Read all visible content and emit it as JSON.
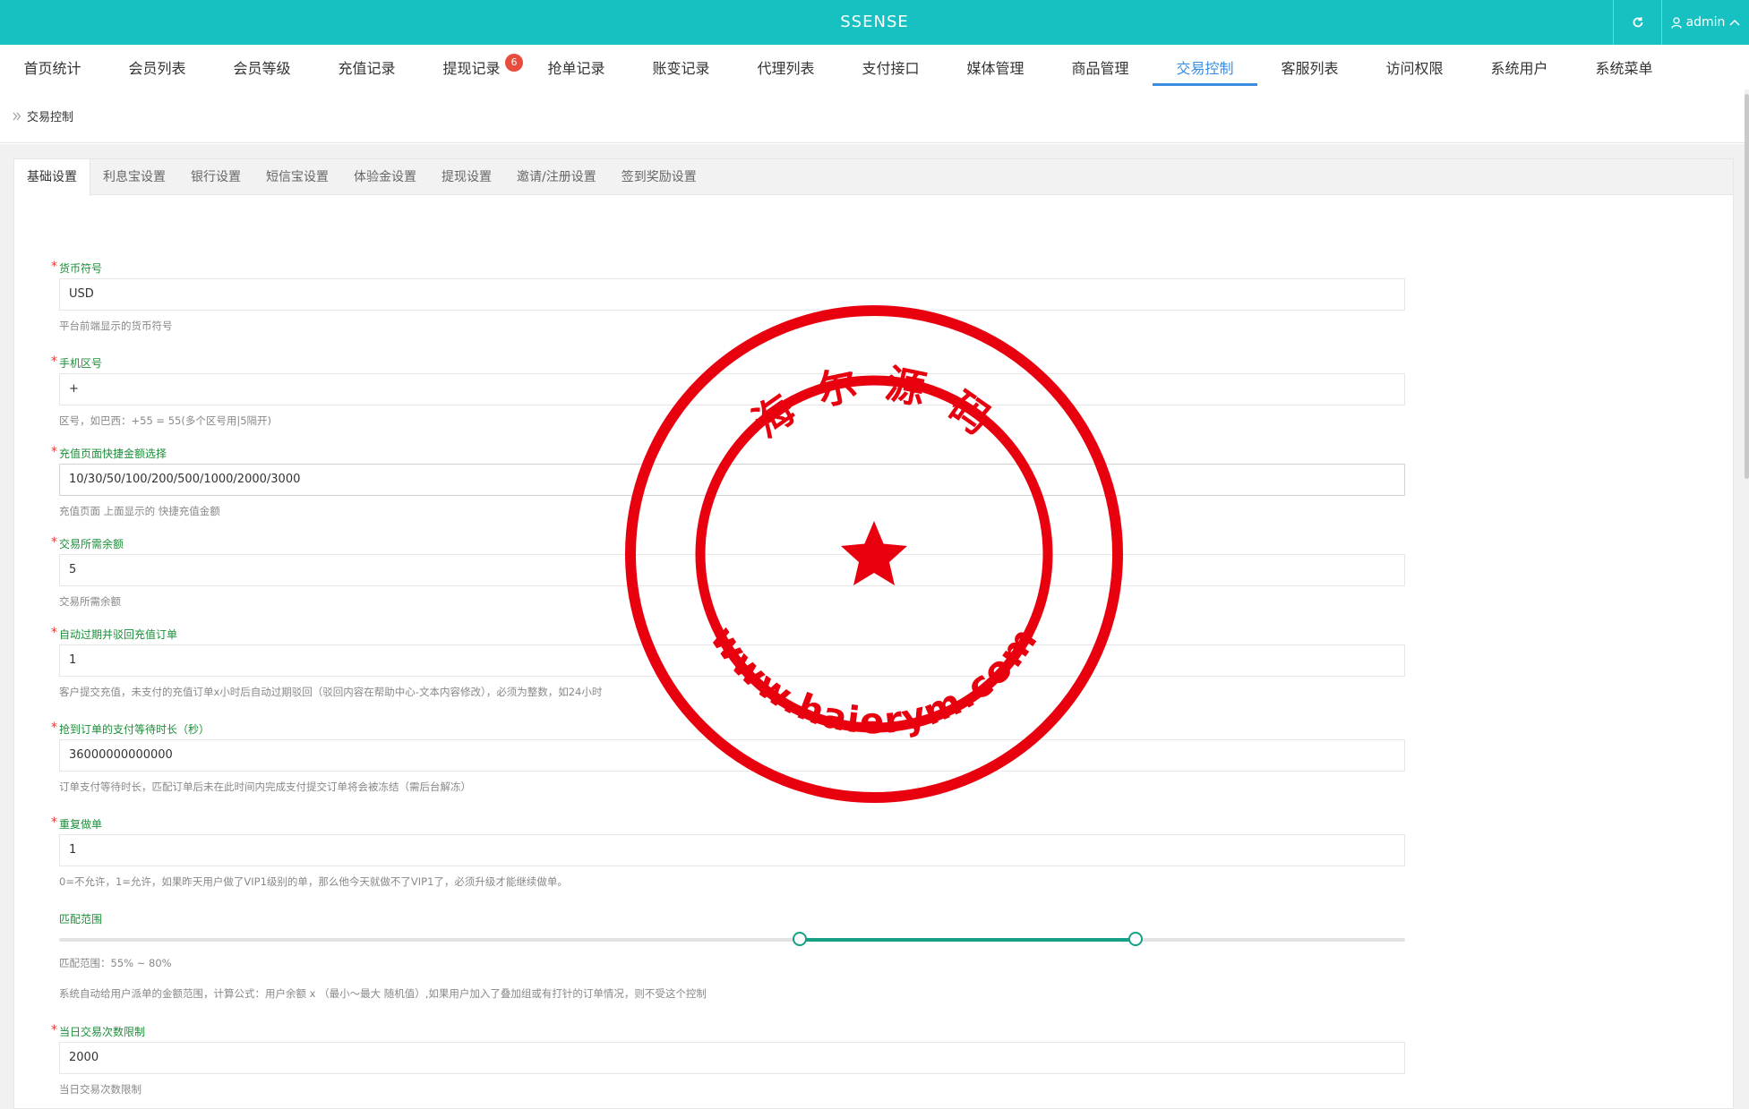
{
  "header": {
    "brand": "SSENSE",
    "user": "admin",
    "refresh_icon": "refresh-icon",
    "user_icon": "user-icon",
    "caret_icon": "chevron-up-icon",
    "bg_color": "#17c1c1"
  },
  "nav": {
    "items": [
      {
        "label": "首页统计"
      },
      {
        "label": "会员列表"
      },
      {
        "label": "会员等级"
      },
      {
        "label": "充值记录"
      },
      {
        "label": "提现记录"
      },
      {
        "label": "抢单记录"
      },
      {
        "label": "账变记录"
      },
      {
        "label": "代理列表"
      },
      {
        "label": "支付接口"
      },
      {
        "label": "媒体管理"
      },
      {
        "label": "商品管理"
      },
      {
        "label": "交易控制"
      },
      {
        "label": "客服列表"
      },
      {
        "label": "访问权限"
      },
      {
        "label": "系统用户"
      },
      {
        "label": "系统菜单"
      }
    ],
    "active_index": 11,
    "badge_count": "6",
    "active_color": "#3a8de0"
  },
  "breadcrumb": {
    "current": "交易控制"
  },
  "tabs": [
    {
      "label": "基础设置"
    },
    {
      "label": "利息宝设置"
    },
    {
      "label": "银行设置"
    },
    {
      "label": "短信宝设置"
    },
    {
      "label": "体验金设置"
    },
    {
      "label": "提现设置"
    },
    {
      "label": "邀请/注册设置"
    },
    {
      "label": "签到奖励设置"
    }
  ],
  "form": {
    "currency": {
      "label": "货币符号",
      "value": "USD",
      "help": "平台前端显示的货币符号"
    },
    "phone_code": {
      "label": "手机区号",
      "value": "+",
      "help": "区号，如巴西：+55 = 55(多个区号用|5隔开)"
    },
    "recharge_amounts": {
      "label": "充值页面快捷金额选择",
      "value": "10/30/50/100/200/500/1000/2000/3000",
      "help": "充值页面 上面显示的 快捷充值金额"
    },
    "min_balance": {
      "label": "交易所需余额",
      "value": "5",
      "help": "交易所需余额"
    },
    "auto_expire": {
      "label": "自动过期并驳回充值订单",
      "value": "1",
      "help": "客户提交充值，未支付的充值订单x小时后自动过期驳回（驳回内容在帮助中心-文本内容修改），必须为整数，如24小时"
    },
    "pay_wait": {
      "label": "抢到订单的支付等待时长（秒）",
      "value": "36000000000000",
      "help": "订单支付等待时长，匹配订单后未在此时间内完成支付提交订单将会被冻结（需后台解冻）"
    },
    "repeat_order": {
      "label": "重复做单",
      "value": "1",
      "help": "0=不允许，1=允许，如果昨天用户做了VIP1级别的单，那么他今天就做不了VIP1了，必须升级才能继续做单。"
    },
    "match_range": {
      "label": "匹配范围",
      "range_text": "匹配范围：55% ~ 80%",
      "min": 55,
      "max": 80,
      "help": "系统自动给用户派单的金额范围，计算公式：用户余额 x （最小～最大 随机值）,如果用户加入了叠加组或有打针的订单情况，则不受这个控制",
      "fill_color": "#16a085"
    },
    "daily_limit": {
      "label": "当日交易次数限制",
      "value": "2000",
      "help": "当日交易次数限制"
    }
  },
  "stamp": {
    "top_text": "海 尔 源 码",
    "bottom_text": "www.haierym.com",
    "color": "#e8000e"
  }
}
